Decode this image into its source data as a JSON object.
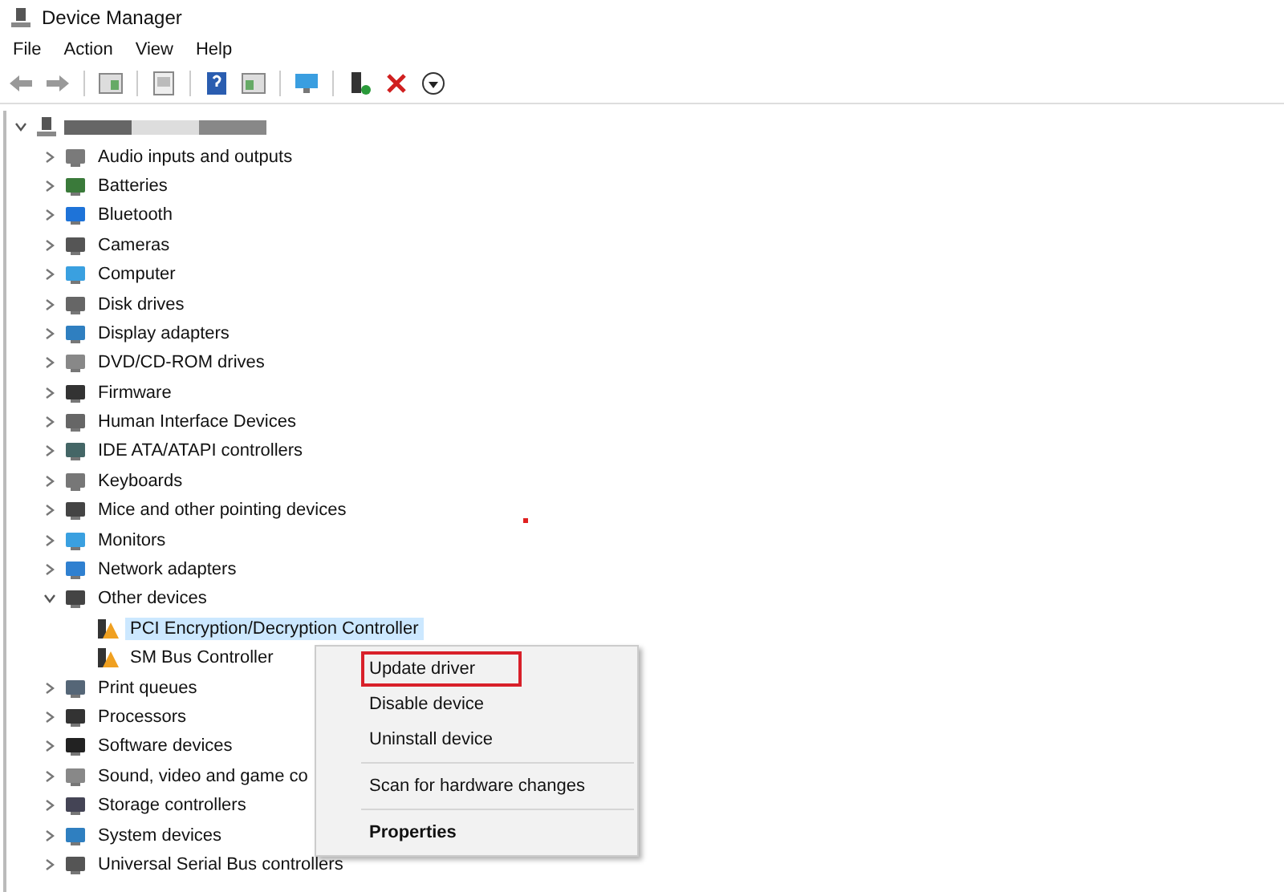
{
  "window": {
    "title": "Device Manager"
  },
  "menu_bar": [
    "File",
    "Action",
    "View",
    "Help"
  ],
  "tree": {
    "root": {
      "expanded": true,
      "name_redacted": true
    },
    "items": [
      {
        "label": "Audio inputs and outputs",
        "expanded": false
      },
      {
        "label": "Batteries",
        "expanded": false
      },
      {
        "label": "Bluetooth",
        "expanded": false
      },
      {
        "label": "Cameras",
        "expanded": false
      },
      {
        "label": "Computer",
        "expanded": false
      },
      {
        "label": "Disk drives",
        "expanded": false
      },
      {
        "label": "Display adapters",
        "expanded": false
      },
      {
        "label": "DVD/CD-ROM drives",
        "expanded": false
      },
      {
        "label": "Firmware",
        "expanded": false
      },
      {
        "label": "Human Interface Devices",
        "expanded": false
      },
      {
        "label": "IDE ATA/ATAPI controllers",
        "expanded": false
      },
      {
        "label": "Keyboards",
        "expanded": false
      },
      {
        "label": "Mice and other pointing devices",
        "expanded": false
      },
      {
        "label": "Monitors",
        "expanded": false
      },
      {
        "label": "Network adapters",
        "expanded": false
      },
      {
        "label": "Other devices",
        "expanded": true,
        "children": [
          {
            "label": "PCI Encryption/Decryption Controller",
            "selected": true,
            "warning": true
          },
          {
            "label": "SM Bus Controller",
            "selected": false,
            "warning": true
          }
        ]
      },
      {
        "label": "Print queues",
        "expanded": false
      },
      {
        "label": "Processors",
        "expanded": false
      },
      {
        "label": "Software devices",
        "expanded": false
      },
      {
        "label": "Sound, video and game co",
        "expanded": false
      },
      {
        "label": "Storage controllers",
        "expanded": false
      },
      {
        "label": "System devices",
        "expanded": false
      },
      {
        "label": "Universal Serial Bus controllers",
        "expanded": false
      }
    ]
  },
  "context_menu": [
    {
      "label": "Update driver",
      "outlined": true,
      "bold": false,
      "separator_before": false
    },
    {
      "label": "Disable device",
      "outlined": false,
      "bold": false,
      "separator_before": false
    },
    {
      "label": "Uninstall device",
      "outlined": false,
      "bold": false,
      "separator_before": false
    },
    {
      "label": "Scan for hardware changes",
      "outlined": false,
      "bold": false,
      "separator_before": true
    },
    {
      "label": "Properties",
      "outlined": false,
      "bold": true,
      "separator_before": true
    }
  ]
}
